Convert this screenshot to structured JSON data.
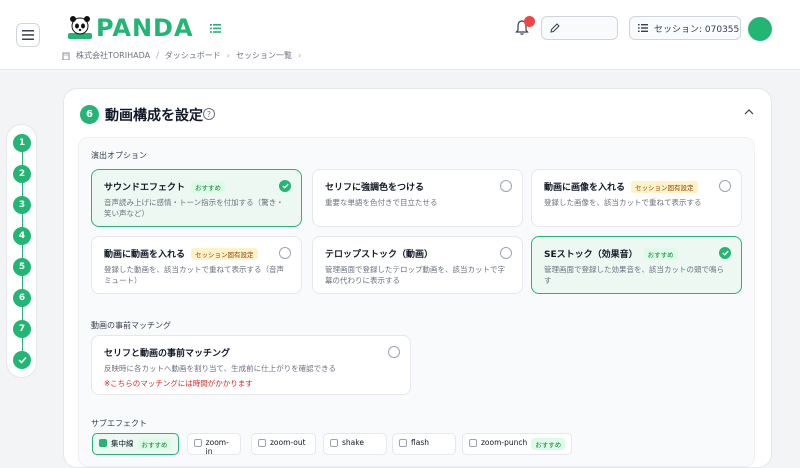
{
  "header": {
    "logo_text": "PANDA",
    "breadcrumb": {
      "company": "株式会社TORIHADA",
      "items": [
        "ダッシュボード",
        "セッション一覧"
      ]
    },
    "session_label": "セッション: 070355"
  },
  "stepper": {
    "steps": [
      "1",
      "2",
      "3",
      "4",
      "5",
      "6",
      "7"
    ]
  },
  "section": {
    "number": "6",
    "title": "動画構成を設定",
    "help": "?"
  },
  "options_label": "演出オプション",
  "options": [
    {
      "title": "サウンドエフェクト",
      "badge": "おすすめ",
      "desc": "音声読み上げに感情・トーン指示を付加する（驚き・笑い声など）",
      "selected": true
    },
    {
      "title": "セリフに強調色をつける",
      "badge": "",
      "desc": "重要な単語を色付きで目立たせる",
      "selected": false
    },
    {
      "title": "動画に画像を入れる",
      "badge": "セッション固有設定",
      "desc": "登録した画像を、該当カットで重ねて表示する",
      "selected": false
    },
    {
      "title": "動画に動画を入れる",
      "badge": "セッション固有設定",
      "desc": "登録した動画を、該当カットで重ねて表示する（音声ミュート）",
      "selected": false
    },
    {
      "title": "テロップストック（動画）",
      "badge": "",
      "desc": "管理画面で登録したテロップ動画を、該当カットで字幕の代わりに表示する",
      "selected": false
    },
    {
      "title": "SEストック（効果音）",
      "badge": "おすすめ",
      "desc": "管理画面で登録した効果音を、該当カットの頭で鳴らす",
      "selected": true
    }
  ],
  "matching_label": "動画の事前マッチング",
  "matching": {
    "title": "セリフと動画の事前マッチング",
    "desc": "反映時に各カットへ動画を割り当て、生成前に仕上がりを確認できる",
    "warning": "※こちらのマッチングには時間がかかります"
  },
  "sub_effects_label": "サブエフェクト",
  "sub_effects": [
    {
      "name": "集中線",
      "badge": "おすすめ",
      "selected": true
    },
    {
      "name": "zoom-in",
      "badge": "",
      "selected": false
    },
    {
      "name": "zoom-out",
      "badge": "",
      "selected": false
    },
    {
      "name": "shake",
      "badge": "",
      "selected": false
    },
    {
      "name": "flash",
      "badge": "",
      "selected": false
    },
    {
      "name": "zoom-punch",
      "badge": "おすすめ",
      "selected": false
    }
  ],
  "colors": {
    "accent": "#22b573",
    "warning": "#dc2626",
    "notification": "#ef4444"
  }
}
